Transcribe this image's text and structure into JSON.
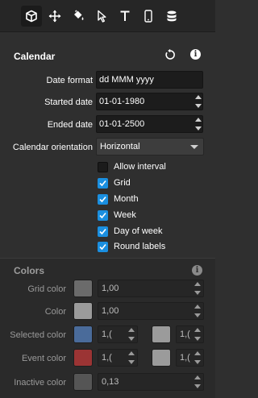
{
  "toolbar": {
    "tools": [
      {
        "icon": "cube-icon",
        "active": true
      },
      {
        "icon": "move-icon",
        "active": false
      },
      {
        "icon": "paint-bucket-icon",
        "active": false
      },
      {
        "icon": "pointer-icon",
        "active": false
      },
      {
        "icon": "text-icon",
        "active": false
      },
      {
        "icon": "mobile-device-icon",
        "active": false
      },
      {
        "icon": "database-icon",
        "active": false
      }
    ]
  },
  "calendar": {
    "title": "Calendar",
    "reset_icon": "reset-icon",
    "info_icon": "info-icon",
    "info_glyph": "i",
    "date_format": {
      "label": "Date format",
      "value": "dd MMM yyyy"
    },
    "started_date": {
      "label": "Started date",
      "value": "01-01-1980"
    },
    "ended_date": {
      "label": "Ended date",
      "value": "01-01-2500"
    },
    "orientation": {
      "label": "Calendar orientation",
      "value": "Horizontal"
    },
    "options": [
      {
        "label": "Allow interval",
        "checked": false
      },
      {
        "label": "Grid",
        "checked": true
      },
      {
        "label": "Month",
        "checked": true
      },
      {
        "label": "Week",
        "checked": true
      },
      {
        "label": "Day of week",
        "checked": true
      },
      {
        "label": "Round labels",
        "checked": true
      }
    ]
  },
  "colors": {
    "title": "Colors",
    "info_glyph": "i",
    "rows": [
      {
        "label": "Grid color",
        "swatch": "#6b6b6b",
        "value": "1,00"
      },
      {
        "label": "Color",
        "swatch": "#9b9b9b",
        "value": "1,00"
      },
      {
        "label": "Selected color",
        "swatch": "#4a6b9a",
        "value": "1,(",
        "swatch2": "#9b9b9b",
        "value2": "1,("
      },
      {
        "label": "Event color",
        "swatch": "#9b3434",
        "value": "1,(",
        "swatch2": "#9b9b9b",
        "value2": "1,("
      },
      {
        "label": "Inactive color",
        "swatch": "#555555",
        "value": "0,13"
      }
    ]
  },
  "accent_color": "#1a8fe0"
}
